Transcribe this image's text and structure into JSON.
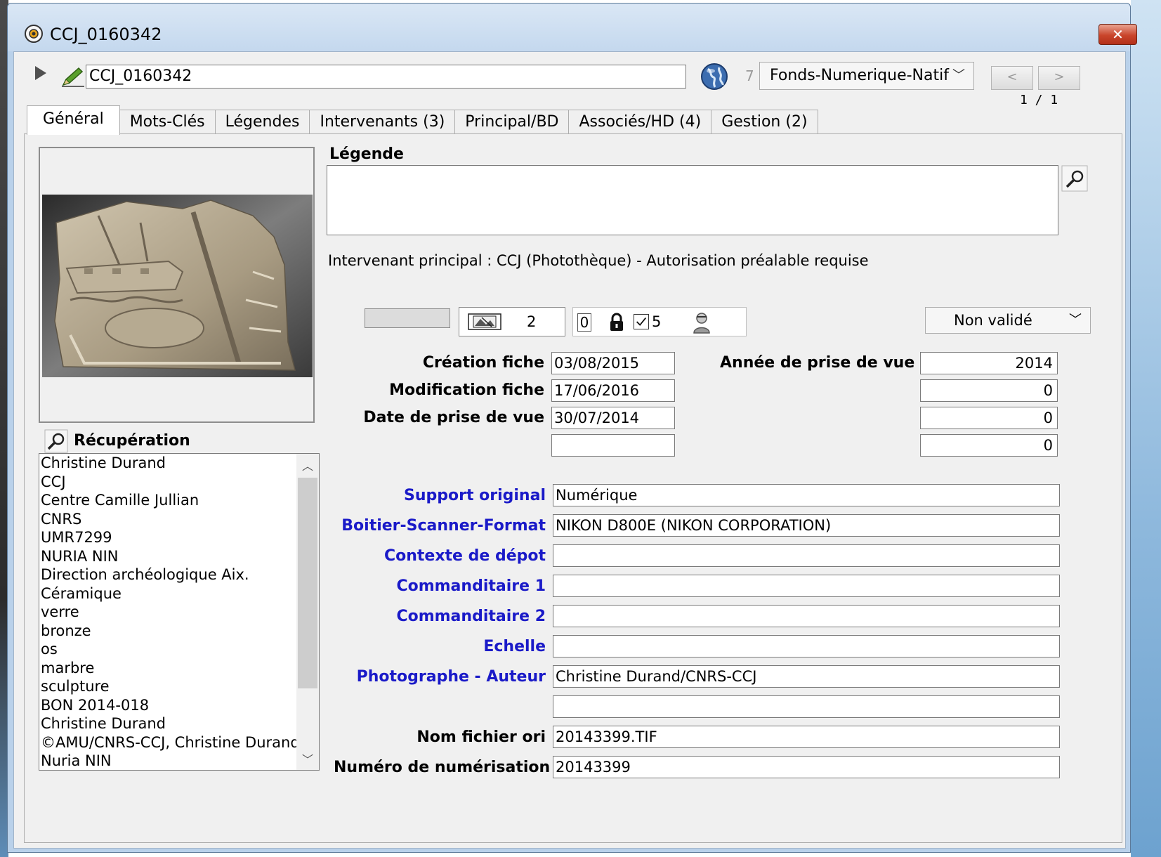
{
  "window": {
    "title": "CCJ_0160342",
    "close_label": "✕"
  },
  "toolbar": {
    "record_name": "CCJ_0160342",
    "count": "7",
    "fonds": "Fonds-Numerique-Natif",
    "prev_label": "<",
    "next_label": ">",
    "page": "1 / 1"
  },
  "tabs": [
    {
      "label": "Général",
      "active": true
    },
    {
      "label": "Mots-Clés"
    },
    {
      "label": "Légendes"
    },
    {
      "label": "Intervenants (3)"
    },
    {
      "label": "Principal/BD"
    },
    {
      "label": "Associés/HD (4)"
    },
    {
      "label": "Gestion (2)"
    }
  ],
  "recuperation": {
    "title": "Récupération",
    "items": [
      "Christine Durand",
      "CCJ",
      "Centre Camille Jullian",
      "CNRS",
      "UMR7299",
      "NURIA NIN",
      "Direction archéologique Aix.",
      "Céramique",
      "verre",
      "bronze",
      "os",
      "marbre",
      "sculpture",
      "BON 2014-018",
      "Christine Durand",
      "©AMU/CNRS-CCJ, Christine Durand",
      "Nuria NIN"
    ]
  },
  "legende": {
    "title": "Légende",
    "value": ""
  },
  "intervenant_text": "Intervenant principal : CCJ (Photothèque) - Autorisation préalable requise",
  "status": {
    "image_count": "2",
    "zero_value": "0",
    "checked_count": "5",
    "validation": "Non validé"
  },
  "dates": {
    "creation_label": "Création fiche",
    "creation_value": "03/08/2015",
    "modification_label": "Modification fiche",
    "modification_value": "17/06/2016",
    "prise_label": "Date de prise de vue",
    "prise_value": "30/07/2014",
    "extra_value": "",
    "annee_label": "Année de prise de vue",
    "annee_value": "2014",
    "num1": "0",
    "num2": "0",
    "num3": "0"
  },
  "fields": {
    "support_label": "Support original",
    "support_value": "Numérique",
    "boitier_label": "Boitier-Scanner-Format",
    "boitier_value": "NIKON D800E (NIKON CORPORATION)",
    "contexte_label": "Contexte de dépot",
    "contexte_value": "",
    "commanditaire1_label": "Commanditaire 1",
    "commanditaire1_value": "",
    "commanditaire2_label": "Commanditaire 2",
    "commanditaire2_value": "",
    "echelle_label": "Echelle",
    "echelle_value": "",
    "photographe_label": "Photographe - Auteur",
    "photographe_value": "Christine Durand/CNRS-CCJ",
    "extra_value": "",
    "nom_fichier_label": "Nom fichier ori",
    "nom_fichier_value": "20143399.TIF",
    "numero_label": "Numéro de numérisation",
    "numero_value": "20143399"
  },
  "colors": {
    "link_label": "#1a1ac8",
    "window_frame": "#b9d1ea",
    "close_button": "#c9452b"
  }
}
